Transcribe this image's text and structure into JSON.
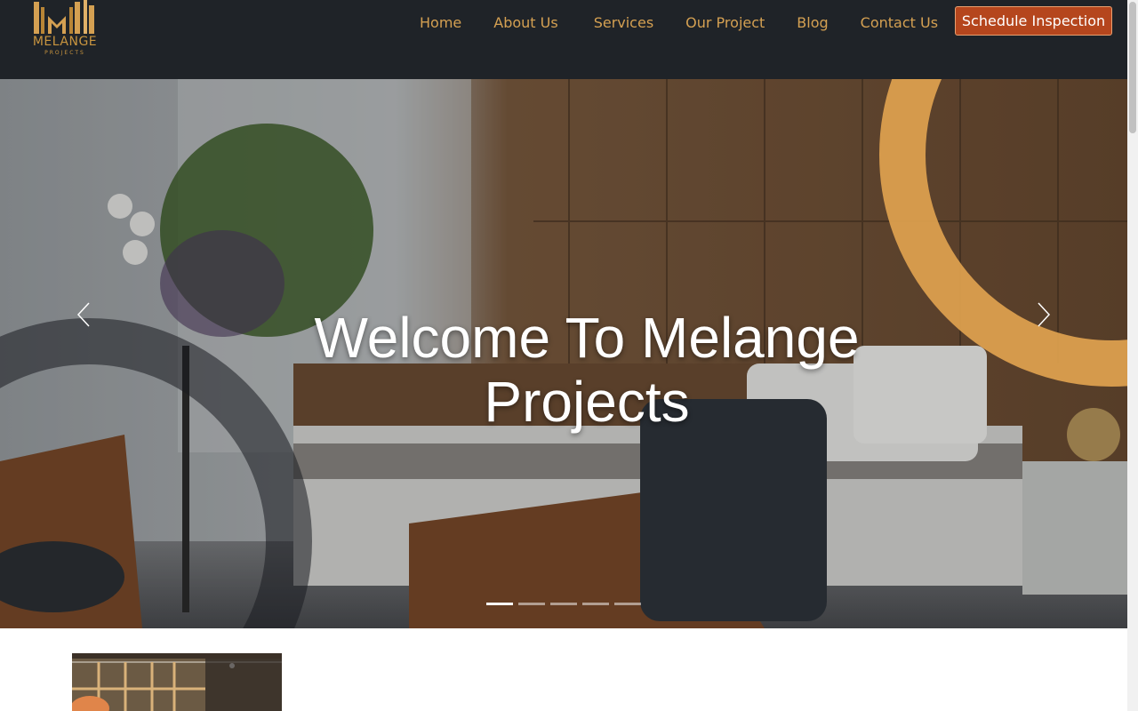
{
  "brand": {
    "name": "MELANGE",
    "tagline": "PROJECTS",
    "gold": "#c9953f"
  },
  "nav": {
    "items": [
      {
        "label": "Home"
      },
      {
        "label": "About Us"
      },
      {
        "label": "Services"
      },
      {
        "label": "Our Project"
      },
      {
        "label": "Blog"
      },
      {
        "label": "Contact Us"
      }
    ],
    "cta_label": "Schedule Inspection",
    "text_color": "#d4a052",
    "cta_color": "#b5461d"
  },
  "hero": {
    "title": "Welcome To Melange Projects",
    "slide_count": 5,
    "active_slide": 1,
    "prev_icon": "chevron-left-icon",
    "next_icon": "chevron-right-icon"
  },
  "colors": {
    "header_bg": "#1f2328",
    "accent_ring": "#e0a24f"
  }
}
